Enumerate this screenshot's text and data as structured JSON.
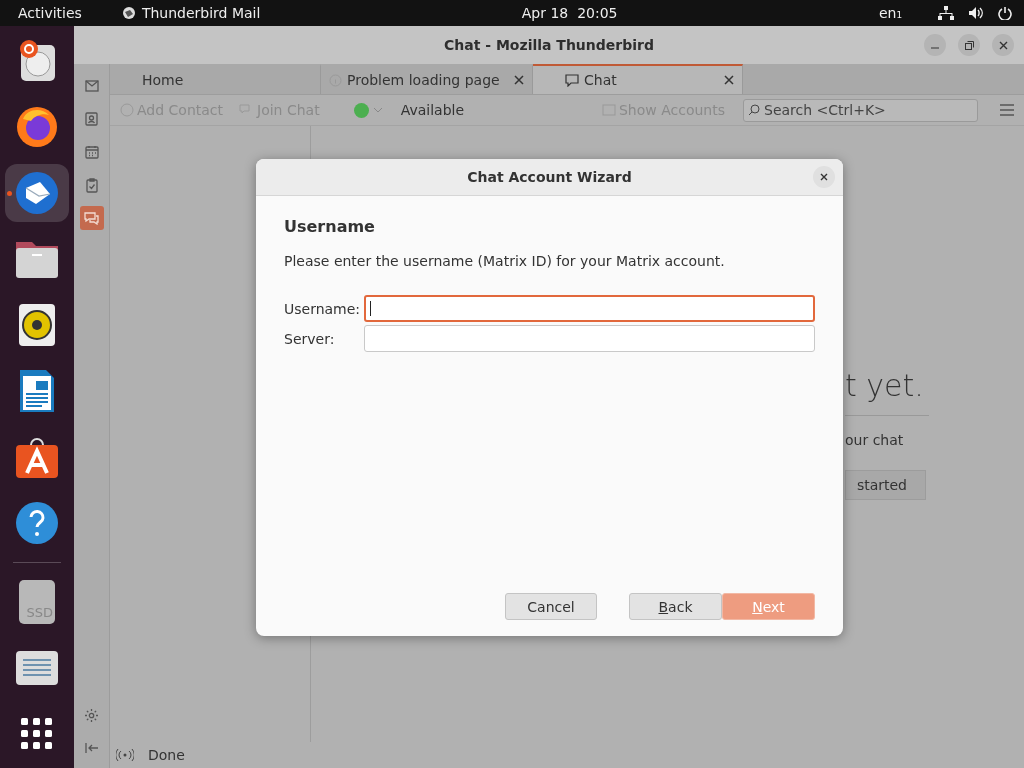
{
  "top_bar": {
    "activities": "Activities",
    "app_name": "Thunderbird Mail",
    "clock": "Apr 18  20:05",
    "keyboard": "en₁"
  },
  "dock": {
    "items": [
      {
        "kind": "installer",
        "selected": false,
        "running": false
      },
      {
        "kind": "browser",
        "selected": false,
        "running": false
      },
      {
        "kind": "mail",
        "selected": true,
        "running": true
      },
      {
        "kind": "folder",
        "selected": false,
        "running": false
      },
      {
        "kind": "speaker",
        "selected": false,
        "running": false
      },
      {
        "kind": "document",
        "selected": false,
        "running": false
      },
      {
        "kind": "store",
        "selected": false,
        "running": false
      },
      {
        "kind": "help",
        "selected": false,
        "running": false
      },
      {
        "kind": "separator"
      },
      {
        "kind": "drive",
        "label": "SSD",
        "selected": false,
        "running": false
      },
      {
        "kind": "scanner",
        "selected": false,
        "running": false
      },
      {
        "kind": "grid",
        "selected": false,
        "running": false
      }
    ]
  },
  "window": {
    "title": "Chat - Mozilla Thunderbird"
  },
  "spaces": [
    {
      "kind": "mail",
      "selected": false
    },
    {
      "kind": "contacts",
      "selected": false
    },
    {
      "kind": "calendar",
      "selected": false
    },
    {
      "kind": "tasks",
      "selected": false
    },
    {
      "kind": "chat",
      "selected": true
    }
  ],
  "tabs": [
    {
      "label": "Home",
      "kind": "home",
      "closable": false,
      "selected": false
    },
    {
      "label": "Problem loading page",
      "kind": "error",
      "closable": true,
      "selected": false
    },
    {
      "label": "Chat",
      "kind": "chat",
      "closable": true,
      "selected": true
    }
  ],
  "toolbar": {
    "add_contact": "Add Contact",
    "join_chat": "Join Chat",
    "status": "Available",
    "show_accounts": "Show Accounts",
    "search": {
      "placeholder": "Search <Ctrl+K>"
    }
  },
  "background_content": {
    "heading": "t yet.",
    "text": "our chat",
    "button": "started"
  },
  "status_bar": {
    "text": "Done"
  },
  "dialog": {
    "title": "Chat Account Wizard",
    "heading": "Username",
    "description": "Please enter the username (Matrix ID) for your Matrix account.",
    "fields": [
      {
        "label": "Username:",
        "focused": true
      },
      {
        "label": "Server:",
        "focused": false
      }
    ],
    "buttons": [
      {
        "label": "Cancel",
        "kind": "cancel",
        "disabled": false
      },
      {
        "label": "Back",
        "kind": "back",
        "disabled": false
      },
      {
        "label": "Next",
        "kind": "primary",
        "disabled": true
      }
    ]
  }
}
